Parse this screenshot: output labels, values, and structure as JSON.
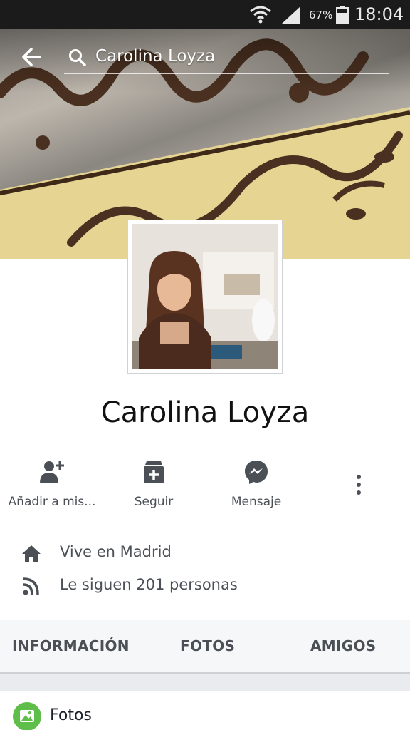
{
  "status_bar": {
    "battery_percent": "67%",
    "time": "18:04"
  },
  "search": {
    "query": "Carolina Loyza"
  },
  "profile": {
    "name": "Carolina Loyza"
  },
  "actions": [
    {
      "label": "Añadir a mis...",
      "icon": "add-friend-icon"
    },
    {
      "label": "Seguir",
      "icon": "follow-icon"
    },
    {
      "label": "Mensaje",
      "icon": "messenger-icon"
    }
  ],
  "info": [
    {
      "text": "Vive en Madrid",
      "icon": "home-icon"
    },
    {
      "text": "Le siguen 201 personas",
      "icon": "rss-icon"
    }
  ],
  "tabs": [
    "INFORMACIÓN",
    "FOTOS",
    "AMIGOS"
  ],
  "section": {
    "label": "Fotos",
    "icon": "photos-icon"
  },
  "colors": {
    "status_bar": "#1b1b1b",
    "icon_gray": "#4b4f56",
    "photos_green": "#5fbd4a"
  }
}
